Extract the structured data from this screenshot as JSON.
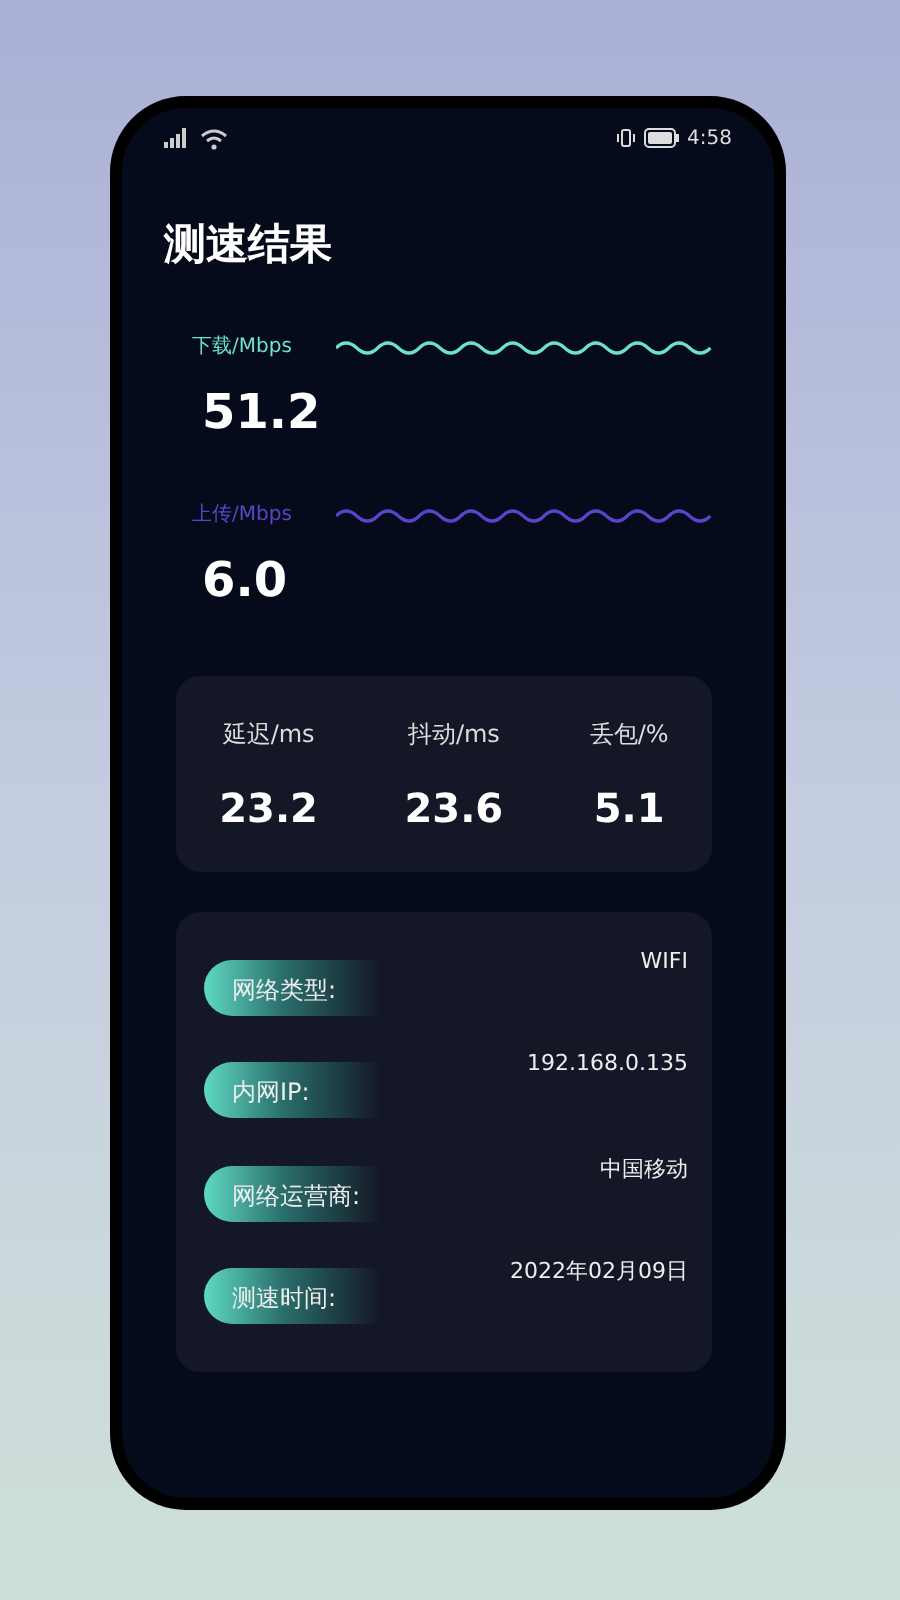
{
  "status_bar": {
    "time": "4:58"
  },
  "title": "测速结果",
  "speeds": [
    {
      "kind": "download",
      "label": "下载/Mbps",
      "value": "51.2"
    },
    {
      "kind": "upload",
      "label": "上传/Mbps",
      "value": "6.0"
    }
  ],
  "stats": [
    {
      "label": "延迟/ms",
      "value": "23.2"
    },
    {
      "label": "抖动/ms",
      "value": "23.6"
    },
    {
      "label": "丢包/%",
      "value": "5.1"
    }
  ],
  "info": [
    {
      "label": "网络类型:",
      "value": "WIFI"
    },
    {
      "label": "内网IP:",
      "value": "192.168.0.135"
    },
    {
      "label": "网络运营商:",
      "value": "中国移动"
    },
    {
      "label": "测速时间:",
      "value": "2022年02月09日"
    }
  ]
}
